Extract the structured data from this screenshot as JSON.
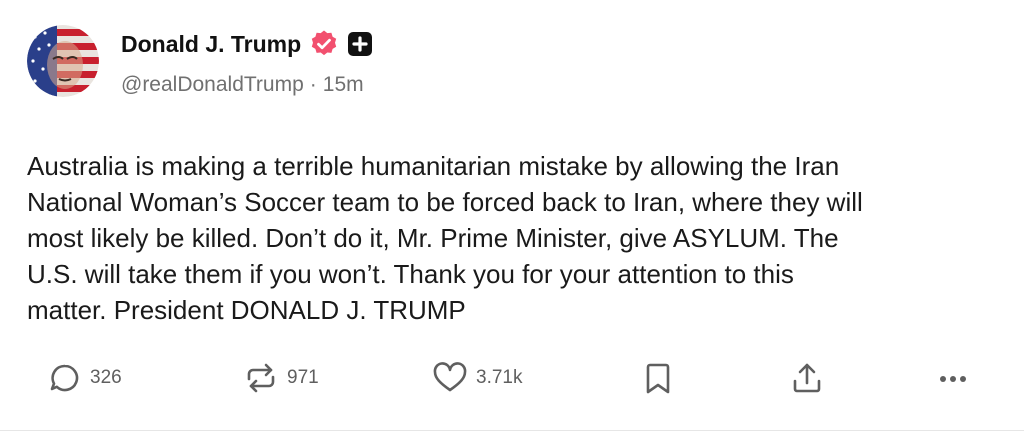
{
  "author": {
    "display_name": "Donald J. Trump",
    "handle": "@realDonaldTrump",
    "separator": "·",
    "timestamp": "15m",
    "verified_icon": "verified-badge-icon",
    "extra_badge_icon": "plus-square-icon",
    "verified_color": "#f2506f"
  },
  "post": {
    "text": "Australia is making a terrible humanitarian mistake by allowing the Iran\nNational Woman’s Soccer team to be forced back to Iran, where they will\nmost likely be killed. Don’t do it, Mr. Prime Minister, give ASYLUM. The\nU.S. will take them if you won’t. Thank you for your attention to this\nmatter. President DONALD J. TRUMP"
  },
  "actions": {
    "reply": {
      "icon": "reply-bubble-icon",
      "count": "326"
    },
    "repost": {
      "icon": "repost-arrows-icon",
      "count": "971"
    },
    "like": {
      "icon": "heart-icon",
      "count": "3.71k"
    },
    "bookmark": {
      "icon": "bookmark-icon"
    },
    "share": {
      "icon": "share-upload-icon"
    },
    "more": {
      "icon": "more-dots-icon"
    }
  }
}
